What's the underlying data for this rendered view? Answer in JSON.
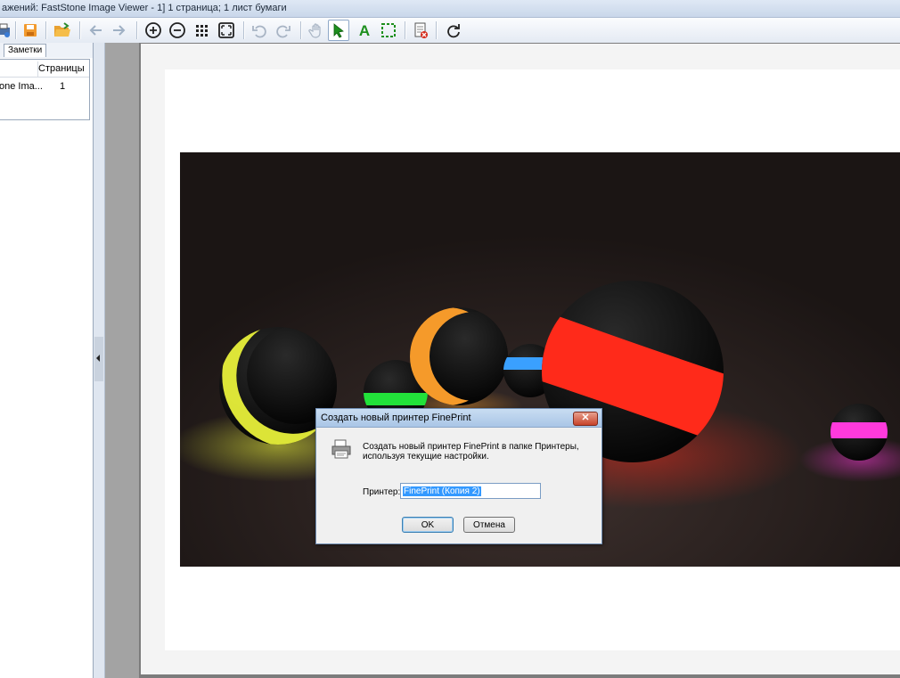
{
  "window": {
    "title": "ажений: FastStone Image Viewer - 1] 1 страница; 1 лист бумаги"
  },
  "toolbar": {
    "items": [
      "printer-icon",
      "save-icon",
      "open-folder-icon",
      "back-arrow-icon",
      "forward-arrow-icon",
      "zoom-in-icon",
      "zoom-out-icon",
      "grid-icon",
      "fit-icon",
      "undo-icon",
      "redo-icon",
      "hand-icon",
      "select-arrow-icon",
      "text-tool-icon",
      "selection-rect-icon",
      "delete-page-icon",
      "rotate-icon"
    ]
  },
  "left_panel": {
    "tab_label": "Заметки",
    "columns": [
      "",
      "Страницы"
    ],
    "rows": [
      {
        "name": "one Ima...",
        "pages": "1"
      }
    ]
  },
  "dialog": {
    "title": "Создать новый принтер FinePrint",
    "close_label": "✕",
    "message": "Создать новый принтер FinePrint в папке Принтеры, используя текущие настройки.",
    "printer_label": "Принтер:",
    "printer_value": "FinePrint (Копия 2)",
    "ok_label": "OK",
    "cancel_label": "Отмена"
  },
  "colors": {
    "accent": "#3399ff",
    "sphere_yellow": "#e8f03a",
    "sphere_green": "#22e23a",
    "sphere_orange": "#f59a2a",
    "sphere_blue": "#3aa0ff",
    "sphere_red": "#ff2a1a",
    "sphere_magenta": "#ff3adc"
  }
}
